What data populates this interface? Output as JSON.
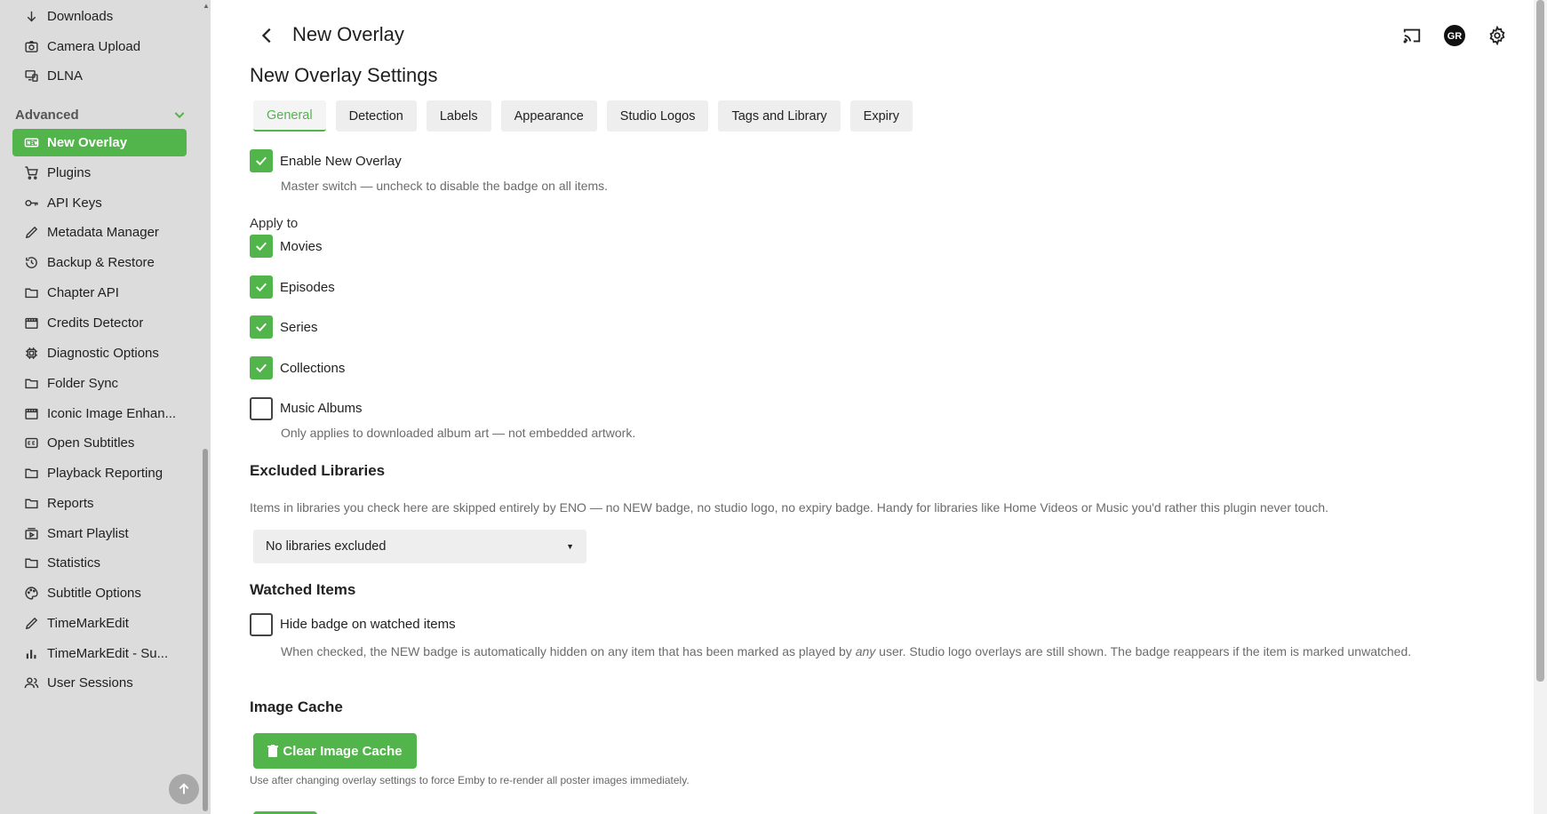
{
  "sidebar": {
    "top_items": [
      {
        "label": "Downloads",
        "icon": "download-icon"
      },
      {
        "label": "Camera Upload",
        "icon": "camera-icon"
      },
      {
        "label": "DLNA",
        "icon": "dlna-icon"
      }
    ],
    "section_label": "Advanced",
    "items": [
      {
        "label": "New Overlay",
        "icon": "new-badge-icon",
        "active": true
      },
      {
        "label": "Plugins",
        "icon": "cart-icon"
      },
      {
        "label": "API Keys",
        "icon": "key-icon"
      },
      {
        "label": "Metadata Manager",
        "icon": "pencil-icon"
      },
      {
        "label": "Backup & Restore",
        "icon": "restore-icon"
      },
      {
        "label": "Chapter API",
        "icon": "folder-icon"
      },
      {
        "label": "Credits Detector",
        "icon": "film-icon"
      },
      {
        "label": "Diagnostic Options",
        "icon": "chip-icon"
      },
      {
        "label": "Folder Sync",
        "icon": "folder-icon"
      },
      {
        "label": "Iconic Image Enhan...",
        "icon": "film-icon"
      },
      {
        "label": "Open Subtitles",
        "icon": "cc-icon"
      },
      {
        "label": "Playback Reporting",
        "icon": "folder-icon"
      },
      {
        "label": "Reports",
        "icon": "folder-icon"
      },
      {
        "label": "Smart Playlist",
        "icon": "playlist-icon"
      },
      {
        "label": "Statistics",
        "icon": "folder-icon"
      },
      {
        "label": "Subtitle Options",
        "icon": "palette-icon"
      },
      {
        "label": "TimeMarkEdit",
        "icon": "pencil-icon"
      },
      {
        "label": "TimeMarkEdit - Su...",
        "icon": "bar-chart-icon"
      },
      {
        "label": "User Sessions",
        "icon": "users-icon"
      }
    ]
  },
  "header": {
    "title": "New Overlay",
    "settings_title": "New Overlay Settings",
    "avatar_initials": "GR"
  },
  "tabs": [
    {
      "label": "General",
      "active": true
    },
    {
      "label": "Detection"
    },
    {
      "label": "Labels"
    },
    {
      "label": "Appearance"
    },
    {
      "label": "Studio Logos"
    },
    {
      "label": "Tags and Library"
    },
    {
      "label": "Expiry"
    }
  ],
  "general": {
    "enable_label": "Enable New Overlay",
    "enable_checked": true,
    "enable_help": "Master switch — uncheck to disable the badge on all items.",
    "apply_to_label": "Apply to",
    "apply_to": [
      {
        "label": "Movies",
        "checked": true
      },
      {
        "label": "Episodes",
        "checked": true
      },
      {
        "label": "Series",
        "checked": true
      },
      {
        "label": "Collections",
        "checked": true
      },
      {
        "label": "Music Albums",
        "checked": false
      }
    ],
    "music_help": "Only applies to downloaded album art — not embedded artwork.",
    "excluded_heading": "Excluded Libraries",
    "excluded_desc": "Items in libraries you check here are skipped entirely by ENO — no NEW badge, no studio logo, no expiry badge. Handy for libraries like Home Videos or Music you'd rather this plugin never touch.",
    "excluded_select_value": "No libraries excluded",
    "watched_heading": "Watched Items",
    "hide_watched_label": "Hide badge on watched items",
    "hide_watched_checked": false,
    "watched_help_part1": "When checked, the NEW badge is automatically hidden on any item that has been marked as played by ",
    "watched_help_em": "any",
    "watched_help_part2": " user. Studio logo overlays are still shown. The badge reappears if the item is marked unwatched.",
    "cache_heading": "Image Cache",
    "clear_cache_label": "Clear Image Cache",
    "cache_help": "Use after changing overlay settings to force Emby to re-render all poster images immediately."
  },
  "colors": {
    "accent": "#52b54b",
    "sidebar_bg": "#dcdcdc"
  }
}
